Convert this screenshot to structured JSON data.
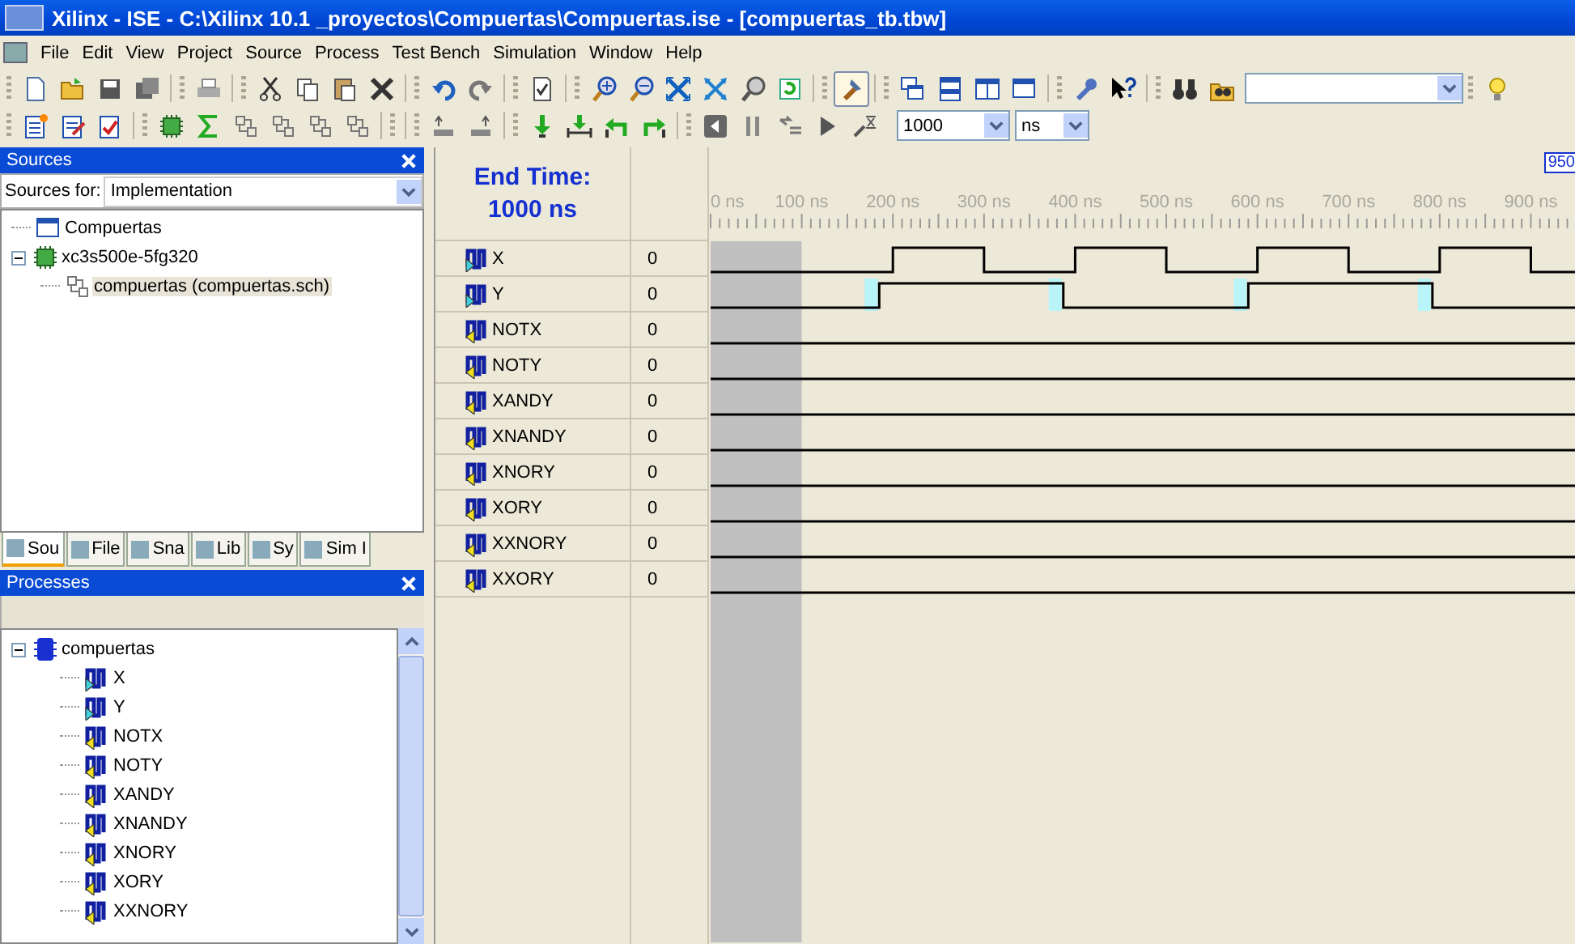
{
  "window": {
    "title": "Xilinx - ISE - C:\\Xilinx 10.1 _proyectos\\Compuertas\\Compuertas.ise - [compuertas_tb.tbw]"
  },
  "menu": [
    "File",
    "Edit",
    "View",
    "Project",
    "Source",
    "Process",
    "Test Bench",
    "Simulation",
    "Window",
    "Help"
  ],
  "toolbar_1": {
    "toggle_buttons": [
      {
        "pressed": true
      }
    ]
  },
  "toolbar_2": {
    "time_value": "1000",
    "time_unit": "ns"
  },
  "sources": {
    "title": "Sources",
    "sources_for_label": "Sources for:",
    "sources_for_value": "Implementation",
    "tree": [
      {
        "label": "Compuertas",
        "kind": "project",
        "selected": false
      },
      {
        "label": "xc3s500e-5fg320",
        "kind": "device",
        "expanded": true,
        "selected": false,
        "children": [
          {
            "label": "compuertas (compuertas.sch)",
            "kind": "schematic",
            "selected": true
          }
        ]
      }
    ],
    "tabs": [
      {
        "label": "Sou",
        "selected": true
      },
      {
        "label": "File",
        "selected": false
      },
      {
        "label": "Sna",
        "selected": false
      },
      {
        "label": "Lib",
        "selected": false
      },
      {
        "label": "Sy",
        "selected": false
      },
      {
        "label": "Sim I",
        "selected": false
      }
    ]
  },
  "processes": {
    "title": "Processes",
    "tree": [
      {
        "label": "compuertas",
        "kind": "module",
        "expanded": true,
        "children": [
          {
            "label": "X",
            "kind": "input"
          },
          {
            "label": "Y",
            "kind": "input"
          },
          {
            "label": "NOTX",
            "kind": "output"
          },
          {
            "label": "NOTY",
            "kind": "output"
          },
          {
            "label": "XANDY",
            "kind": "output"
          },
          {
            "label": "XNANDY",
            "kind": "output"
          },
          {
            "label": "XNORY",
            "kind": "output"
          },
          {
            "label": "XORY",
            "kind": "output"
          },
          {
            "label": "XXNORY",
            "kind": "output"
          }
        ]
      }
    ]
  },
  "waveform": {
    "end_time_label": "End Time:",
    "end_time_value": "1000 ns",
    "cursor_label": "950",
    "ruler_labels": [
      "0 ns",
      "100 ns",
      "200 ns",
      "300 ns",
      "400 ns",
      "500 ns",
      "600 ns",
      "700 ns",
      "800 ns",
      "900 ns"
    ],
    "signals": [
      {
        "name": "X",
        "kind": "input",
        "value": "0"
      },
      {
        "name": "Y",
        "kind": "input",
        "value": "0"
      },
      {
        "name": "NOTX",
        "kind": "output",
        "value": "0"
      },
      {
        "name": "NOTY",
        "kind": "output",
        "value": "0"
      },
      {
        "name": "XANDY",
        "kind": "output",
        "value": "0"
      },
      {
        "name": "XNANDY",
        "kind": "output",
        "value": "0"
      },
      {
        "name": "XNORY",
        "kind": "output",
        "value": "0"
      },
      {
        "name": "XORY",
        "kind": "output",
        "value": "0"
      },
      {
        "name": "XXNORY",
        "kind": "output",
        "value": "0"
      },
      {
        "name": "XXORY",
        "kind": "output",
        "value": "0"
      }
    ]
  }
}
